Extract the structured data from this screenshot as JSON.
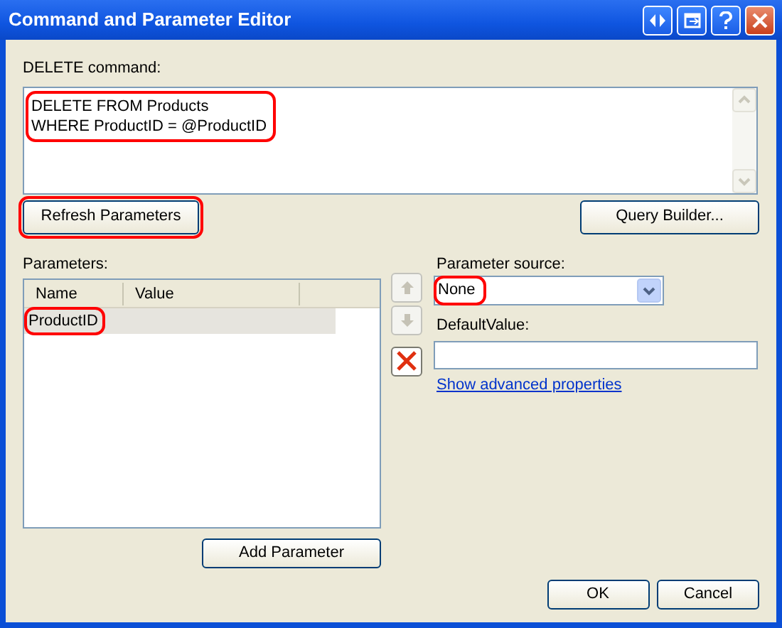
{
  "window": {
    "title": "Command and Parameter Editor"
  },
  "command": {
    "label": "DELETE command:",
    "lines": [
      "DELETE FROM Products",
      "WHERE ProductID = @ProductID"
    ],
    "highlighted": true
  },
  "refresh_button": {
    "label": "Refresh Parameters",
    "highlighted": true
  },
  "query_builder_button": {
    "label": "Query Builder..."
  },
  "parameters": {
    "label": "Parameters:",
    "columns": [
      "Name",
      "Value"
    ],
    "rows": [
      {
        "name": "ProductID",
        "selected": true,
        "highlighted": true
      }
    ]
  },
  "parameter_source": {
    "label": "Parameter source:",
    "value": "None",
    "highlighted": true
  },
  "default_value": {
    "label": "DefaultValue:"
  },
  "advanced_link": "Show advanced properties",
  "add_parameter_button": "Add Parameter",
  "buttons": [
    {
      "label": "OK"
    },
    {
      "label": "Cancel"
    }
  ]
}
